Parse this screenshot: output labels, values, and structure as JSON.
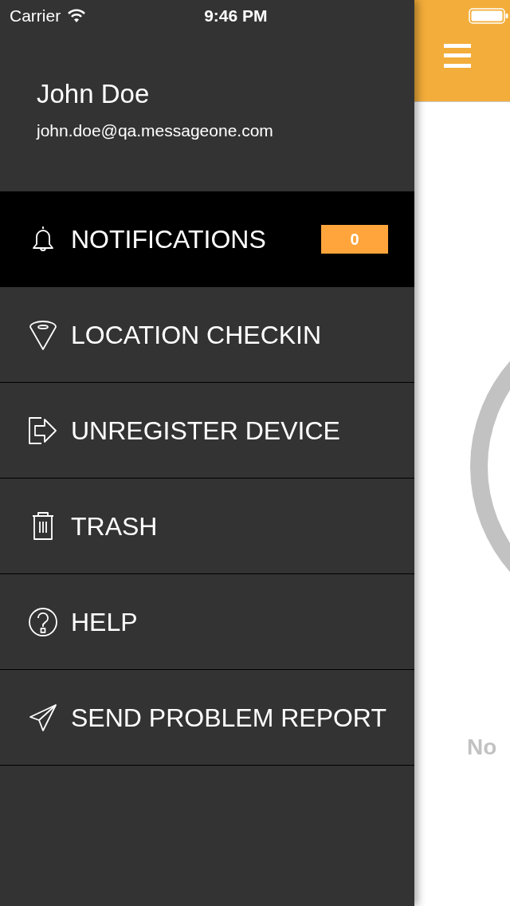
{
  "status_bar": {
    "carrier": "Carrier",
    "time": "9:46 PM"
  },
  "profile": {
    "name": "John Doe",
    "email": "john.doe@qa.messageone.com"
  },
  "menu": [
    {
      "kind": "bell",
      "label": "NOTIFICATIONS",
      "selected": true,
      "badge": "0"
    },
    {
      "kind": "location",
      "label": "LOCATION CHECKIN",
      "selected": false
    },
    {
      "kind": "exit",
      "label": "UNREGISTER DEVICE",
      "selected": false
    },
    {
      "kind": "trash",
      "label": "TRASH",
      "selected": false
    },
    {
      "kind": "help",
      "label": "HELP",
      "selected": false
    },
    {
      "kind": "send",
      "label": "SEND PROBLEM REPORT",
      "selected": false
    }
  ],
  "main": {
    "empty_message": "No"
  }
}
